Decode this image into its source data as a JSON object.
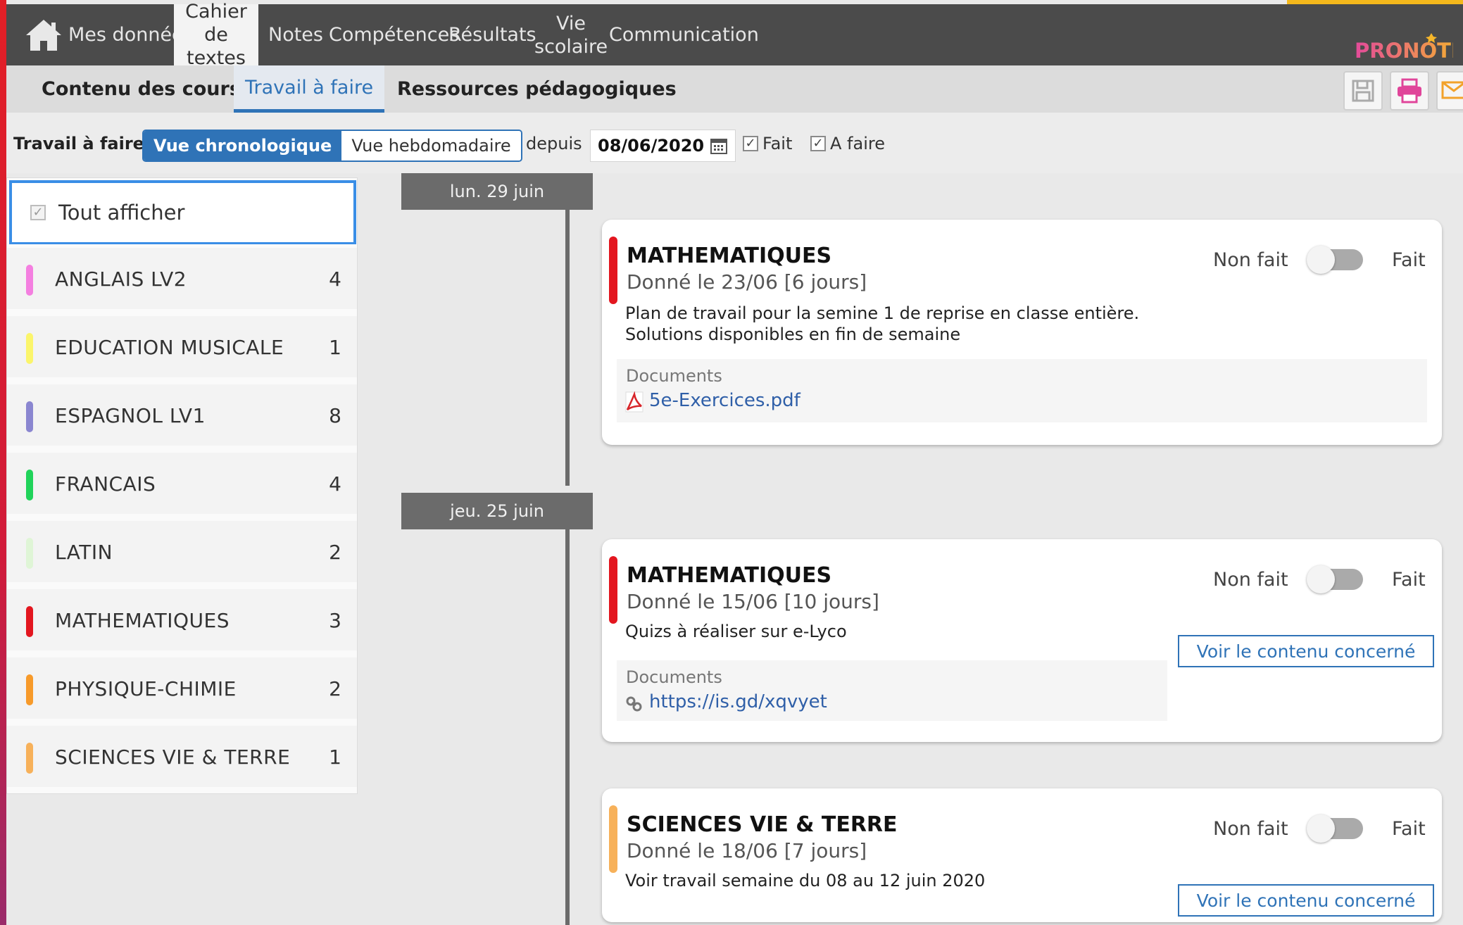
{
  "nav": {
    "items": [
      {
        "label": "Mes données"
      },
      {
        "label": "Cahier\nde textes"
      },
      {
        "label": "Notes"
      },
      {
        "label": "Compétences"
      },
      {
        "label": "Résultats"
      },
      {
        "label": "Vie\nscolaire"
      },
      {
        "label": "Communication"
      }
    ],
    "logo_text": "PRONOTE"
  },
  "subnav": {
    "items": [
      {
        "label": "Contenu des cours"
      },
      {
        "label": "Travail à faire"
      },
      {
        "label": "Ressources pédagogiques"
      }
    ]
  },
  "filter": {
    "label": "Travail à faire",
    "view_chrono": "Vue chronologique",
    "view_weekly": "Vue hebdomadaire",
    "since_label": "depuis",
    "date": "08/06/2020",
    "fait_label": "Fait",
    "afaire_label": "A faire",
    "check_mark": "✓"
  },
  "subjects": {
    "show_all": "Tout afficher",
    "items": [
      {
        "name": "ANGLAIS LV2",
        "count": "4",
        "color": "#f47fe0"
      },
      {
        "name": "EDUCATION MUSICALE",
        "count": "1",
        "color": "#fbf56b"
      },
      {
        "name": "ESPAGNOL LV1",
        "count": "8",
        "color": "#8a86d0"
      },
      {
        "name": "FRANCAIS",
        "count": "4",
        "color": "#20d35a"
      },
      {
        "name": "LATIN",
        "count": "2",
        "color": "#dff5d6"
      },
      {
        "name": "MATHEMATIQUES",
        "count": "3",
        "color": "#e3161f"
      },
      {
        "name": "PHYSIQUE-CHIMIE",
        "count": "2",
        "color": "#f79a2a"
      },
      {
        "name": "SCIENCES VIE & TERRE",
        "count": "1",
        "color": "#f7b15a"
      }
    ]
  },
  "timeline": {
    "dates": [
      "lun. 29 juin",
      "jeu. 25 juin"
    ]
  },
  "cards": [
    {
      "subject": "MATHEMATIQUES",
      "given": "Donné le 23/06 [6 jours]",
      "desc1": "Plan de travail pour la semine 1 de reprise en classe entière.",
      "desc2": "Solutions disponibles en fin de semaine",
      "non_fait": "Non fait",
      "fait": "Fait",
      "docs_label": "Documents",
      "doc": "5e-Exercices.pdf",
      "color": "#e3161f"
    },
    {
      "subject": "MATHEMATIQUES",
      "given": "Donné le 15/06 [10 jours]",
      "desc1": "Quizs à réaliser sur e-Lyco",
      "non_fait": "Non fait",
      "fait": "Fait",
      "docs_label": "Documents",
      "doc": "https://is.gd/xqvyet",
      "voir": "Voir le contenu concerné",
      "color": "#e3161f"
    },
    {
      "subject": "SCIENCES VIE & TERRE",
      "given": "Donné le 18/06 [7 jours]",
      "desc1": "Voir travail semaine du 08 au 12 juin 2020",
      "non_fait": "Non fait",
      "fait": "Fait",
      "voir": "Voir le contenu concerné",
      "color": "#f7b15a"
    }
  ]
}
